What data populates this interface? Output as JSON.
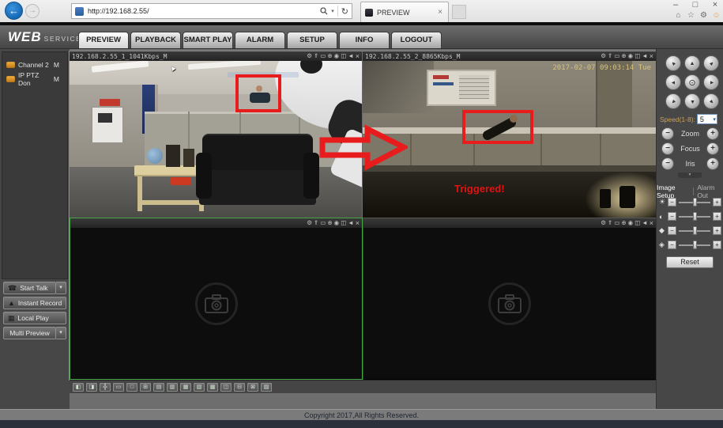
{
  "browser": {
    "url": "http://192.168.2.55/",
    "tab": {
      "title": "PREVIEW"
    }
  },
  "nav": {
    "logo": "WEB",
    "logo_sub": "SERVICE",
    "tabs": [
      {
        "label": "PREVIEW",
        "active": true
      },
      {
        "label": "PLAYBACK",
        "active": false
      },
      {
        "label": "SMART PLAY",
        "active": false
      },
      {
        "label": "ALARM",
        "active": false
      },
      {
        "label": "SETUP",
        "active": false
      },
      {
        "label": "INFO",
        "active": false
      },
      {
        "label": "LOGOUT",
        "active": false
      }
    ]
  },
  "sidebar": {
    "channels": [
      {
        "label": "Channel 2",
        "stream": "M"
      },
      {
        "label": "IP PTZ Don",
        "stream": "M"
      }
    ],
    "buttons": {
      "start_talk": "Start Talk",
      "instant_record": "Instant Record",
      "local_play": "Local Play",
      "multi_preview": "Multi Preview"
    }
  },
  "video": {
    "pane1": {
      "title": "192.168.2.55_1_1041Kbps_M"
    },
    "pane2": {
      "title": "192.168.2.55_2_8865Kbps_M",
      "timestamp": "2017-02-07 09:03:14 Tue",
      "alert": "Triggered!"
    }
  },
  "ptz": {
    "speed_label": "Speed(1-8):",
    "speed_value": "5",
    "zoom": "Zoom",
    "focus": "Focus",
    "iris": "Iris"
  },
  "image_setup": {
    "tab_image_setup": "Image Setup",
    "tab_alarm_out": "Alarm Out",
    "reset": "Reset"
  },
  "footer": {
    "copyright": "Copyright 2017,All Rights Reserved."
  },
  "toolbar": {
    "icons": [
      {
        "name": "image-quality",
        "glyph": "◧"
      },
      {
        "name": "fluency",
        "glyph": "◨"
      },
      {
        "name": "fullscreen",
        "glyph": "╬"
      },
      {
        "name": "aspect-ratio",
        "glyph": "▭"
      },
      {
        "name": "split-1",
        "glyph": "□"
      },
      {
        "name": "split-4",
        "glyph": "⊞"
      },
      {
        "name": "split-6",
        "glyph": "▤"
      },
      {
        "name": "split-8",
        "glyph": "▥"
      },
      {
        "name": "split-9",
        "glyph": "▦"
      },
      {
        "name": "split-13",
        "glyph": "▧"
      },
      {
        "name": "split-16",
        "glyph": "▩"
      },
      {
        "name": "split-20",
        "glyph": "◫"
      },
      {
        "name": "split-25",
        "glyph": "⊟"
      },
      {
        "name": "split-36",
        "glyph": "⊠"
      },
      {
        "name": "custom-split",
        "glyph": "▨"
      }
    ]
  },
  "glyphs": {
    "back": "←",
    "forward": "→",
    "caret_down": "▾",
    "refresh": "↻",
    "tab_close": "×",
    "minimize": "–",
    "restore": "□",
    "close": "×",
    "home": "⌂",
    "favorites": "☆",
    "tools": "⚙",
    "feedback": "☺",
    "dropdown": "▾",
    "phone": "☎",
    "record_tri": "▲",
    "disk": "▦",
    "gear": "⚙",
    "upload": "⇑",
    "frame": "▭",
    "zoom_in": "⊕",
    "record": "◉",
    "snapshot": "◫",
    "audio": "◄",
    "pane_close": "×",
    "dir": "▲",
    "center": "⊙",
    "minus": "−",
    "plus": "+",
    "brightness": "☀",
    "contrast": "◐",
    "saturation": "◆",
    "hue": "◈",
    "collapse": "▼"
  },
  "colors": {
    "alert_red": "#e81c1c",
    "selected_green": "#46a546",
    "timestamp": "#d5c27c"
  }
}
